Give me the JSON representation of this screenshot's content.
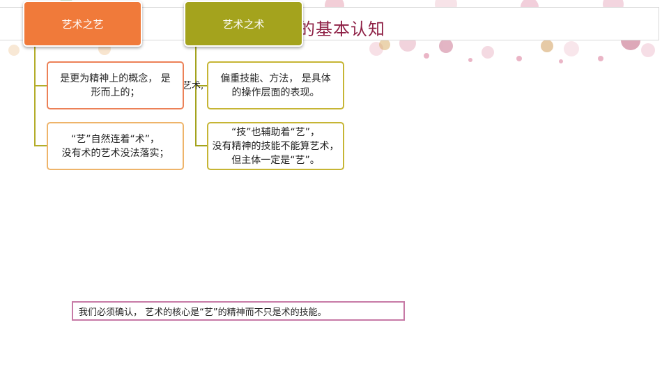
{
  "slide": {
    "title": "的基本认知",
    "behind_text": "艺术,"
  },
  "categories": [
    {
      "label": "艺术之艺",
      "color": "#f07a3a"
    },
    {
      "label": "艺术之术",
      "color": "#a4a31d"
    }
  ],
  "nodes": {
    "art_1": "是更为精神上的概念， 是\n形而上的；",
    "art_2": "“艺”自然连着“术”，\n没有术的艺术没法落实；",
    "tech_1": "偏重技能、方法， 是具体\n的操作层面的表现。",
    "tech_2": "“技”也辅助着“艺”，\n没有精神的技能不能算艺术，\n但主体一定是“艺”。"
  },
  "summary": "我们必须确认， 艺术的核心是“艺”的精神而不只是术的技能。",
  "colors": {
    "title": "#8e2045",
    "art_connector": "#b4ad2a",
    "tech_connector": "#a4a31d",
    "summary_border": "#c77aa6"
  }
}
